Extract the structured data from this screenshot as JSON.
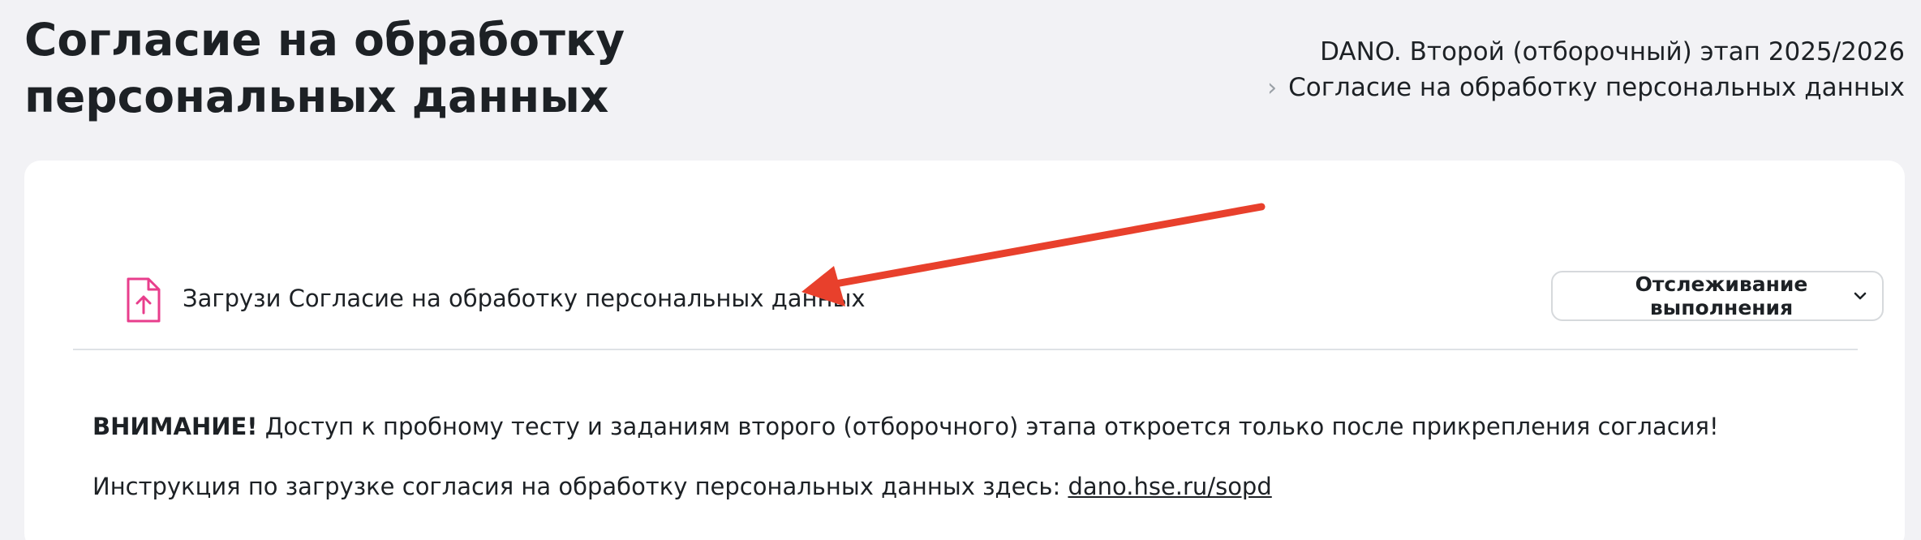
{
  "header": {
    "title": "Согласие на обработку персональных данных"
  },
  "breadcrumb": {
    "items": [
      "DANO. Второй (отборочный) этап 2025/2026",
      "Согласие на обработку персональных данных"
    ],
    "separator_icon": "chevron-right-icon"
  },
  "activity": {
    "icon": "file-upload-icon",
    "icon_color": "#e83e8c",
    "name": "Загрузи Согласие на обработку персональных данных",
    "tracking_button_label": "Отслеживание выполнения",
    "tracking_button_icon": "chevron-down-icon"
  },
  "notice": {
    "warning_label": "ВНИМАНИЕ!",
    "warning_text": " Доступ к пробному тесту и заданиям второго (отборочного) этапа откроется только после прикрепления согласия!",
    "instruction_text": "Инструкция по загрузке согласия на обработку персональных данных здесь: ",
    "instruction_link": "dano.hse.ru/sopd"
  },
  "annotation": {
    "arrow_color": "#e8402c"
  }
}
